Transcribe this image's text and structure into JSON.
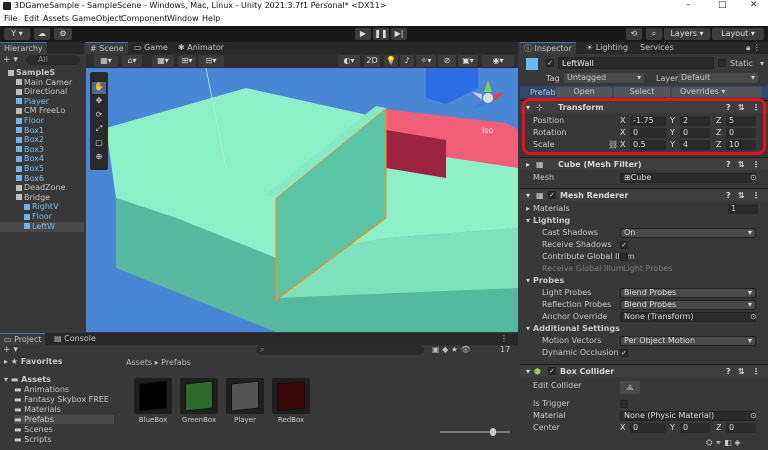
{
  "window": {
    "title": "3DGameSample - SampleScene - Windows, Mac, Linux - Unity 2021.3.7f1 Personal* <DX11>"
  },
  "menu": [
    "File",
    "Edit",
    "Assets",
    "GameObject",
    "Component",
    "Window",
    "Help"
  ],
  "toolbar": {
    "account": "Y",
    "layers": "Layers",
    "layout": "Layout"
  },
  "tabs": {
    "hierarchy": "Hierarchy",
    "scene": "Scene",
    "game": "Game",
    "animator": "Animator",
    "inspector": "Inspector",
    "lighting": "Lighting",
    "services": "Services",
    "project": "Project",
    "console": "Console"
  },
  "hierarchy": {
    "search_placeholder": "All",
    "items": [
      {
        "label": "SampleS",
        "indent": 1,
        "bold": true
      },
      {
        "label": "Main Camer",
        "indent": 2
      },
      {
        "label": "Directional",
        "indent": 2
      },
      {
        "label": "Player",
        "indent": 2,
        "prefab": true
      },
      {
        "label": "CM FreeLo",
        "indent": 2
      },
      {
        "label": "Floor",
        "indent": 2,
        "prefab": true
      },
      {
        "label": "Box1",
        "indent": 2,
        "prefab": true
      },
      {
        "label": "Box2",
        "indent": 2,
        "prefab": true
      },
      {
        "label": "Box3",
        "indent": 2,
        "prefab": true
      },
      {
        "label": "Box4",
        "indent": 2,
        "prefab": true
      },
      {
        "label": "Box5",
        "indent": 2,
        "prefab": true
      },
      {
        "label": "Box6",
        "indent": 2,
        "prefab": true
      },
      {
        "label": "DeadZone",
        "indent": 2
      },
      {
        "label": "Bridge",
        "indent": 2
      },
      {
        "label": "RightV",
        "indent": 3,
        "prefab": true
      },
      {
        "label": "Floor",
        "indent": 3,
        "prefab": true
      },
      {
        "label": "LeftW",
        "indent": 3,
        "prefab": true,
        "selected": true
      }
    ]
  },
  "scene": {
    "mode_2d": "2D",
    "persp": "Iso"
  },
  "inspector": {
    "object_name": "LeftWall",
    "static_label": "Static",
    "tag_label": "Tag",
    "tag_value": "Untagged",
    "layer_label": "Layer",
    "layer_value": "Default",
    "prefab_label": "Prefab",
    "prefab_open": "Open",
    "prefab_select": "Select",
    "prefab_overrides": "Overrides",
    "transform": {
      "title": "Transform",
      "position_label": "Position",
      "position": {
        "x": "-1.75",
        "y": "2",
        "z": "5"
      },
      "rotation_label": "Rotation",
      "rotation": {
        "x": "0",
        "y": "0",
        "z": "0"
      },
      "scale_label": "Scale",
      "scale": {
        "x": "0.5",
        "y": "4",
        "z": "10"
      }
    },
    "mesh_filter": {
      "title": "Cube (Mesh Filter)",
      "mesh_label": "Mesh",
      "mesh_value": "Cube"
    },
    "mesh_renderer": {
      "title": "Mesh Renderer",
      "materials_label": "Materials",
      "materials_count": "1",
      "lighting_label": "Lighting",
      "cast_shadows_label": "Cast Shadows",
      "cast_shadows": "On",
      "receive_shadows_label": "Receive Shadows",
      "contribute_gi_label": "Contribute Global Illum",
      "receive_gi_label": "Receive Global Illum",
      "receive_gi": "Light Probes",
      "probes_label": "Probes",
      "light_probes_label": "Light Probes",
      "light_probes": "Blend Probes",
      "reflection_probes_label": "Reflection Probes",
      "reflection_probes": "Blend Probes",
      "anchor_label": "Anchor Override",
      "anchor": "None (Transform)",
      "additional_label": "Additional Settings",
      "motion_vectors_label": "Motion Vectors",
      "motion_vectors": "Per Object Motion",
      "dynamic_occlusion_label": "Dynamic Occlusion"
    },
    "box_collider": {
      "title": "Box Collider",
      "edit_label": "Edit Collider",
      "trigger_label": "Is Trigger",
      "material_label": "Material",
      "material_value": "None (Physic Material)",
      "center_label": "Center",
      "center": {
        "x": "0",
        "y": "0",
        "z": "0"
      }
    }
  },
  "project": {
    "favorites": "Favorites",
    "assets": "Assets",
    "folders": [
      "Animations",
      "Fantasy Skybox FREE",
      "Materials",
      "Prefabs",
      "Scenes",
      "Scripts"
    ],
    "breadcrumb_root": "Assets",
    "breadcrumb_leaf": "Prefabs",
    "count": "17",
    "items": [
      {
        "name": "BlueBox",
        "color": "#000000"
      },
      {
        "name": "GreenBox",
        "color": "#2f6b2a"
      },
      {
        "name": "Player",
        "color": "#555555"
      },
      {
        "name": "RedBox",
        "color": "#3a0a0a"
      }
    ]
  },
  "highlight_color": "#e8101a"
}
